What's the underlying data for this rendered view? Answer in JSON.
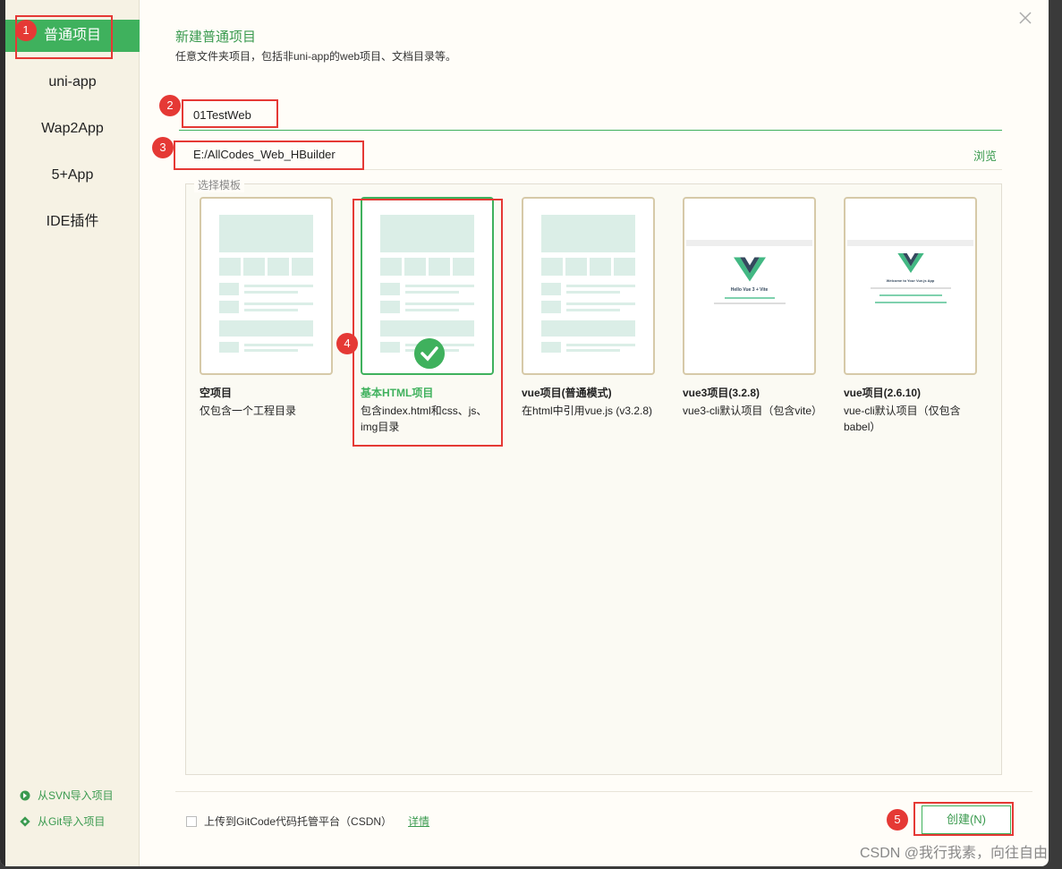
{
  "sidebar": {
    "items": [
      {
        "label": "普通项目"
      },
      {
        "label": "uni-app"
      },
      {
        "label": "Wap2App"
      },
      {
        "label": "5+App"
      },
      {
        "label": "IDE插件"
      }
    ],
    "svn_link": "从SVN导入项目",
    "git_link": "从Git导入项目"
  },
  "header": {
    "title": "新建普通项目",
    "subtitle": "任意文件夹项目，包括非uni-app的web项目、文档目录等。"
  },
  "form": {
    "project_name": "01TestWeb",
    "project_path": "E:/AllCodes_Web_HBuilder",
    "browse_label": "浏览",
    "template_legend": "选择模板"
  },
  "templates": [
    {
      "title": "空项目",
      "desc": "仅包含一个工程目录"
    },
    {
      "title": "基本HTML项目",
      "desc": "包含index.html和css、js、img目录"
    },
    {
      "title": "vue项目(普通模式)",
      "desc": "在html中引用vue.js (v3.2.8)"
    },
    {
      "title": "vue3项目(3.2.8)",
      "desc": "vue3-cli默认项目（包含vite）",
      "preview_heading": "Hello Vue 3 + Vite"
    },
    {
      "title": "vue项目(2.6.10)",
      "desc": "vue-cli默认项目（仅包含babel）",
      "preview_heading": "Welcome to Your Vue.js App"
    }
  ],
  "footer": {
    "upload_label": "上传到GitCode代码托管平台（CSDN）",
    "details_label": "详情",
    "create_label": "创建(N)"
  },
  "badges": [
    "1",
    "2",
    "3",
    "4",
    "5"
  ],
  "watermark": "CSDN @我行我素，向往自由",
  "colors": {
    "accent": "#3fb15d",
    "highlight": "#e53935"
  }
}
